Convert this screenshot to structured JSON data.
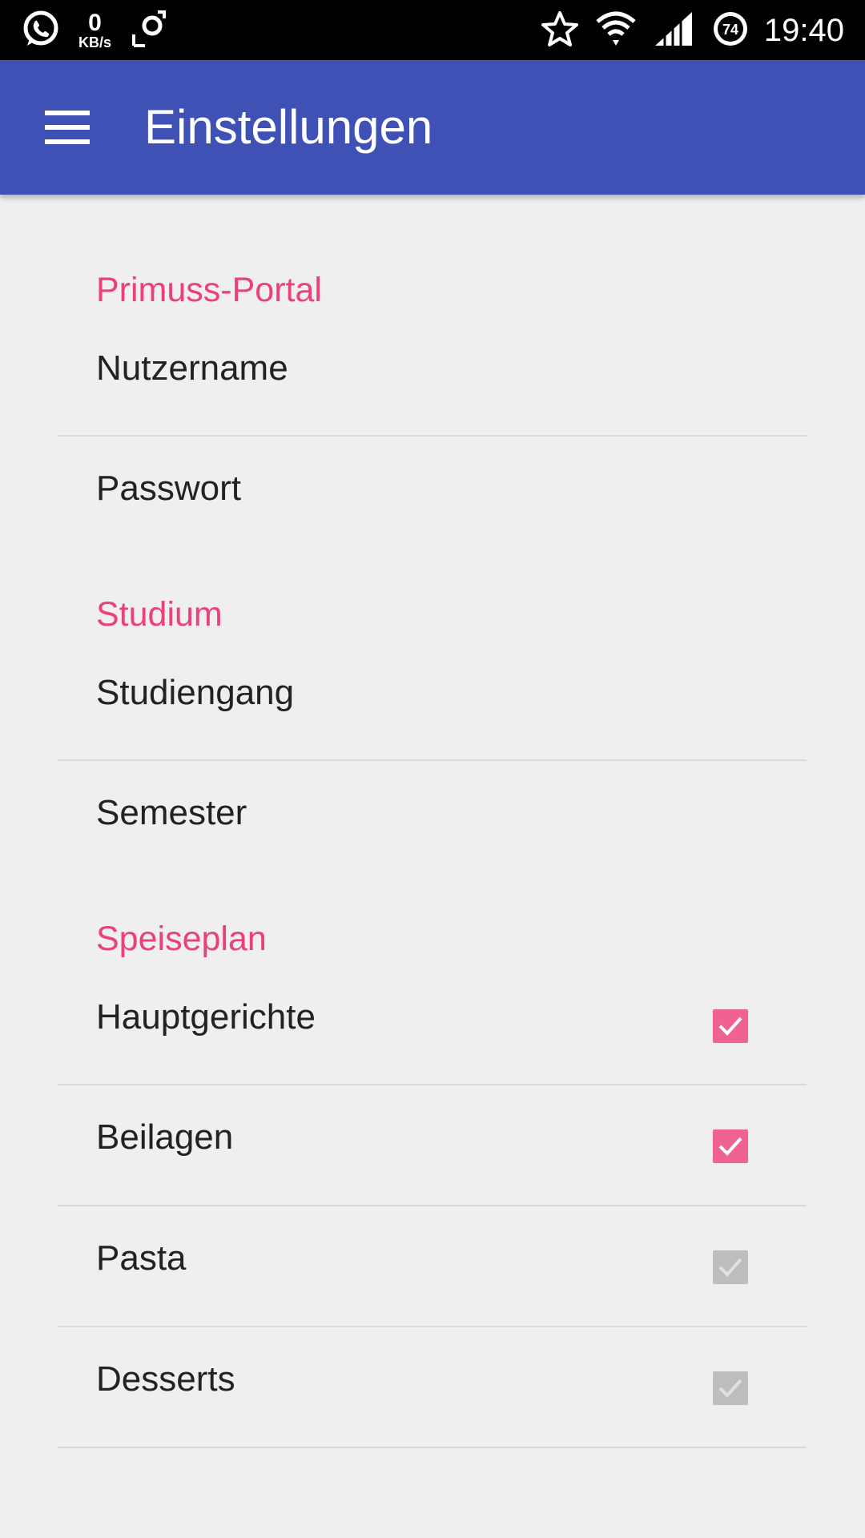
{
  "status_bar": {
    "kbs_value": "0",
    "kbs_unit": "KB/s",
    "battery_level": "74",
    "time": "19:40",
    "icons": [
      "whatsapp-icon",
      "rotate-icon",
      "star-icon",
      "wifi-icon",
      "signal-icon",
      "battery-icon"
    ]
  },
  "app_bar": {
    "title": "Einstellungen",
    "menu_icon": "hamburger-menu-icon",
    "color": "#3f51b5"
  },
  "accent_color": "#ec407a",
  "categories": [
    {
      "title": "Primuss-Portal",
      "items": [
        {
          "label": "Nutzername"
        },
        {
          "label": "Passwort"
        }
      ]
    },
    {
      "title": "Studium",
      "items": [
        {
          "label": "Studiengang"
        },
        {
          "label": "Semester"
        }
      ]
    },
    {
      "title": "Speiseplan",
      "items": [
        {
          "label": "Hauptgerichte",
          "checked": true
        },
        {
          "label": "Beilagen",
          "checked": true
        },
        {
          "label": "Pasta",
          "checked": false
        },
        {
          "label": "Desserts",
          "checked": false
        }
      ]
    }
  ]
}
